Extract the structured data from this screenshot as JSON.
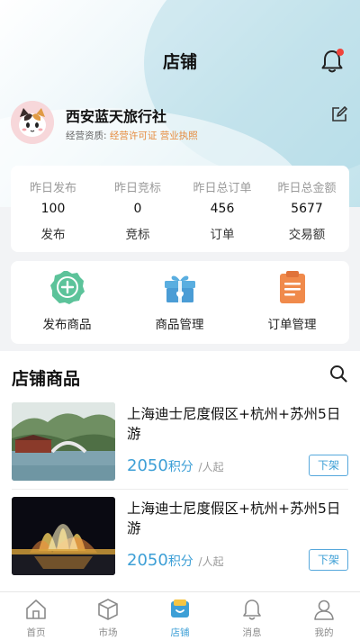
{
  "header": {
    "title": "店铺",
    "notification_icon": "bell-icon",
    "has_badge": true
  },
  "profile": {
    "name": "西安蓝天旅行社",
    "qualification_label": "经营资质:",
    "licenses": [
      "经营许可证",
      "营业执照"
    ],
    "edit_icon": "edit-icon"
  },
  "stats": [
    {
      "label": "昨日发布",
      "value": "100",
      "unit": "发布"
    },
    {
      "label": "昨日竞标",
      "value": "0",
      "unit": "竞标"
    },
    {
      "label": "昨日总订单",
      "value": "456",
      "unit": "订单"
    },
    {
      "label": "昨日总金额",
      "value": "5677",
      "unit": "交易额"
    }
  ],
  "actions": [
    {
      "label": "发布商品",
      "icon": "add-circle-icon"
    },
    {
      "label": "商品管理",
      "icon": "gift-box-icon"
    },
    {
      "label": "订单管理",
      "icon": "clipboard-icon"
    }
  ],
  "products": {
    "heading": "店铺商品",
    "search_icon": "search-icon",
    "items": [
      {
        "title": "上海迪士尼度假区+杭州+苏州5日游",
        "price": "2050",
        "price_unit": "积分",
        "per": "/人起",
        "action": "下架"
      },
      {
        "title": "上海迪士尼度假区+杭州+苏州5日游",
        "price": "2050",
        "price_unit": "积分",
        "per": "/人起",
        "action": "下架"
      }
    ]
  },
  "tabbar": [
    {
      "label": "首页",
      "icon": "home-icon",
      "active": false
    },
    {
      "label": "市场",
      "icon": "market-box-icon",
      "active": false
    },
    {
      "label": "店铺",
      "icon": "store-icon",
      "active": true
    },
    {
      "label": "消息",
      "icon": "bell-icon",
      "active": false
    },
    {
      "label": "我的",
      "icon": "user-icon",
      "active": false
    }
  ],
  "colors": {
    "accent": "#3d9fd6",
    "license": "#e58a3c",
    "badge": "#f0443b"
  }
}
